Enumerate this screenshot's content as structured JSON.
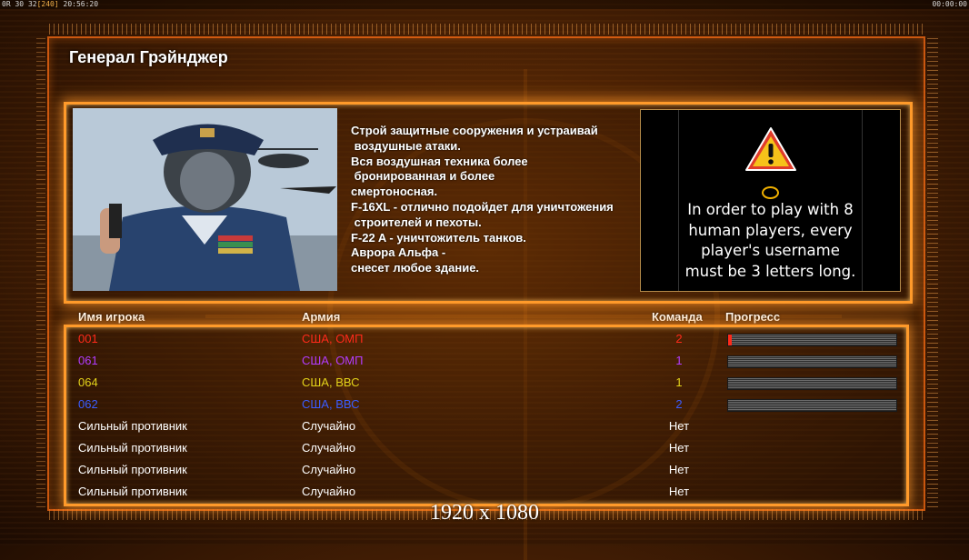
{
  "status_bar": {
    "left_prefix": "0R",
    "left_a": "30",
    "left_b": "32",
    "left_fps": "[240]",
    "left_time": "20:56:20",
    "right_time": "00:00:00"
  },
  "general": {
    "title": "Генерал Грэйнджер",
    "description_lines": [
      "Строй защитные сооружения и устраивай",
      " воздушные атаки.",
      "Вся воздушная техника более",
      " бронированная и более",
      "смертоносная.",
      "F-16XL - отлично подойдет для уничтожения",
      " строителей и пехоты.",
      "F-22 A - уничтожитель танков.",
      "Аврора Альфа -",
      "снесет любое здание."
    ]
  },
  "warning": {
    "icon": "warning-triangle-icon",
    "lines": [
      "In order to play with 8",
      "human players, every",
      "player's username",
      "must be 3 letters long."
    ]
  },
  "players_table": {
    "headers": {
      "name": "Имя игрока",
      "army": "Армия",
      "team": "Команда",
      "progress": "Прогресс"
    },
    "rows": [
      {
        "name": "001",
        "army": "США, ОМП",
        "team": "2",
        "color": "#ff2a1a",
        "progress": 0.02
      },
      {
        "name": "061",
        "army": "США, ОМП",
        "team": "1",
        "color": "#b23cff",
        "progress": 0
      },
      {
        "name": "064",
        "army": "США, ВВС",
        "team": "1",
        "color": "#e3d21a",
        "progress": 0
      },
      {
        "name": "062",
        "army": "США, ВВС",
        "team": "2",
        "color": "#3a5cff",
        "progress": 0
      },
      {
        "name": "Сильный противник",
        "army": "Случайно",
        "team": "Нет",
        "color": "#ffffff",
        "progress": null
      },
      {
        "name": "Сильный противник",
        "army": "Случайно",
        "team": "Нет",
        "color": "#ffffff",
        "progress": null
      },
      {
        "name": "Сильный противник",
        "army": "Случайно",
        "team": "Нет",
        "color": "#ffffff",
        "progress": null
      },
      {
        "name": "Сильный противник",
        "army": "Случайно",
        "team": "Нет",
        "color": "#ffffff",
        "progress": null
      }
    ]
  },
  "resolution_label": "1920 x 1080"
}
